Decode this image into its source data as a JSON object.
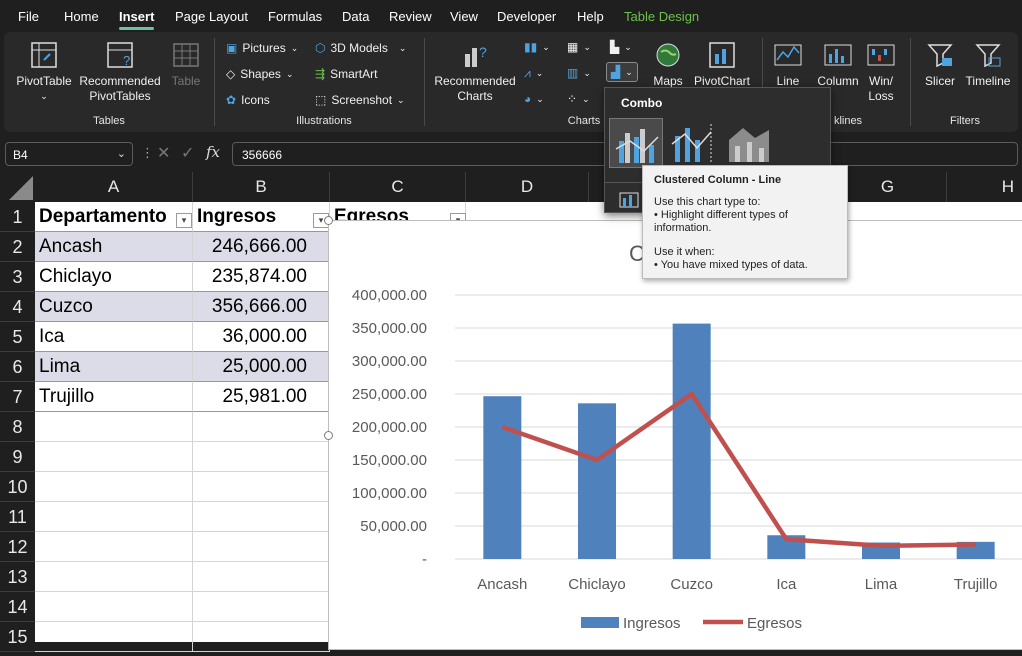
{
  "menu": [
    "File",
    "Home",
    "Insert",
    "Page Layout",
    "Formulas",
    "Data",
    "Review",
    "View",
    "Developer",
    "Help",
    "Table Design"
  ],
  "ribbon": {
    "tables": {
      "pivot_table": "PivotTable",
      "recommended_1": "Recommended",
      "recommended_2": "PivotTables",
      "table": "Table",
      "label": "Tables"
    },
    "illustrations": {
      "pictures": "Pictures",
      "shapes": "Shapes",
      "icons": "Icons",
      "models": "3D Models",
      "smartart": "SmartArt",
      "screenshot": "Screenshot",
      "label": "Illustrations"
    },
    "charts": {
      "rec_1": "Recommended",
      "rec_2": "Charts",
      "maps": "Maps",
      "pivotchart": "PivotChart",
      "label": "Charts"
    },
    "sparklines": {
      "line": "Line",
      "column": "Column",
      "win_1": "Win/",
      "win_2": "Loss",
      "label": "klines"
    },
    "filters": {
      "slicer": "Slicer",
      "timeline": "Timeline",
      "label": "Filters"
    }
  },
  "formula_bar": {
    "name_box": "B4",
    "value": "356666",
    "fx": "fx"
  },
  "columns": [
    "A",
    "B",
    "C",
    "D",
    "E",
    "F",
    "G",
    "H"
  ],
  "rows": [
    "1",
    "2",
    "3",
    "4",
    "5",
    "6",
    "7",
    "8",
    "9",
    "10",
    "11",
    "12",
    "13",
    "14",
    "15"
  ],
  "table": {
    "headers": [
      "Departamento",
      "Ingresos",
      "Egresos"
    ],
    "rows": [
      {
        "dep": "Ancash",
        "ing": "246,666.00"
      },
      {
        "dep": "Chiclayo",
        "ing": "235,874.00"
      },
      {
        "dep": "Cuzco",
        "ing": "356,666.00"
      },
      {
        "dep": "Ica",
        "ing": "36,000.00"
      },
      {
        "dep": "Lima",
        "ing": "25,000.00"
      },
      {
        "dep": "Trujillo",
        "ing": "25,981.00"
      }
    ]
  },
  "combo_menu": {
    "title": "Combo"
  },
  "tooltip": {
    "title": "Clustered Column - Line",
    "line1": "Use this chart type to:",
    "line2": "• Highlight different types of",
    "line3": "information.",
    "line4": "Use it when:",
    "line5": "• You have mixed types of data."
  },
  "colors": {
    "bar": "#4f81bd",
    "line": "#c0504d",
    "accent": "#6cc24a"
  },
  "chart_data": {
    "type": "bar",
    "title": "C",
    "categories": [
      "Ancash",
      "Chiclayo",
      "Cuzco",
      "Ica",
      "Lima",
      "Trujillo"
    ],
    "series": [
      {
        "name": "Ingresos",
        "type": "bar",
        "values": [
          246666,
          235874,
          356666,
          36000,
          25000,
          25981
        ]
      },
      {
        "name": "Egresos",
        "type": "line",
        "values": [
          200000,
          150000,
          250000,
          30000,
          20000,
          22000
        ]
      }
    ],
    "yticks": [
      "-",
      "50,000.00",
      "100,000.00",
      "150,000.00",
      "200,000.00",
      "250,000.00",
      "300,000.00",
      "350,000.00",
      "400,000.00"
    ],
    "ylim": [
      0,
      400000
    ],
    "legend": "bottom",
    "grid": true
  }
}
